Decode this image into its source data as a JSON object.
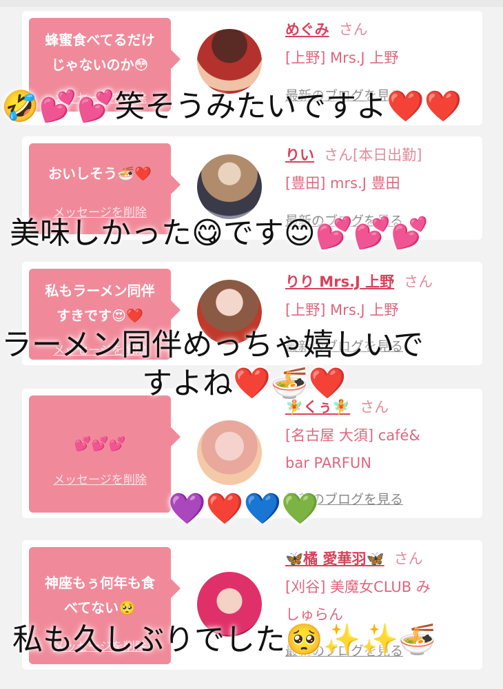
{
  "messages": [
    {
      "bubble_lines": [
        "蜂蜜食べてるだけ",
        "じゃないのか😳"
      ],
      "delete_label": "メッセージを削除",
      "name": "めぐみ",
      "san": "さん",
      "shop_lines": [
        "[上野] Mrs.J 上野"
      ],
      "blog_label": "最新のブログを見る",
      "overlay_lines": [
        "🤣💕💕笑そうみたいですよ❤️❤️"
      ]
    },
    {
      "bubble_lines": [
        "おいしそう🍜❤️"
      ],
      "delete_label": "メッセージを削除",
      "name": "りい",
      "san": "さん[本日出勤]",
      "shop_lines": [
        "[豊田] mrs.J 豊田"
      ],
      "blog_label": "最新のブログを見る",
      "overlay_lines": [
        "美味しかった😋です😊💕💕💕"
      ]
    },
    {
      "bubble_lines": [
        "私もラーメン同伴",
        "すきです😍❤️"
      ],
      "delete_label": "メッセージを削除",
      "name": "りり Mrs.J 上野",
      "san": "さん",
      "shop_lines": [
        "[上野] Mrs.J 上野"
      ],
      "blog_label": "最新のブログを見る",
      "overlay_lines": [
        "ラーメン同伴めっちゃ嬉しいで",
        "すよね❤️🍜❤️"
      ]
    },
    {
      "bubble_lines": [
        "💕💕💕"
      ],
      "delete_label": "メッセージを削除",
      "name": "🧚くぅ🧚",
      "san": "さん",
      "shop_lines": [
        "[名古屋 大須] café&",
        "bar PARFUN"
      ],
      "blog_label": "最新のブログを見る",
      "overlay_lines": [
        "💜❤️💙💚"
      ]
    },
    {
      "bubble_lines": [
        "神座もぅ何年も食",
        "べてない🥺"
      ],
      "delete_label": "メッセージを削除",
      "name": "🦋橘 愛華羽🦋",
      "san": "さん",
      "shop_lines": [
        "[刈谷] 美魔女CLUB み",
        "しゅらん"
      ],
      "blog_label": "最新のブログを見る",
      "overlay_lines": [
        "私も久しぶりでした🥺✨✨🍜"
      ]
    }
  ],
  "colors": {
    "bubble": "#f08a9a",
    "name": "#d9415b",
    "shop": "#e0667e",
    "background": "#f2f2f2"
  }
}
